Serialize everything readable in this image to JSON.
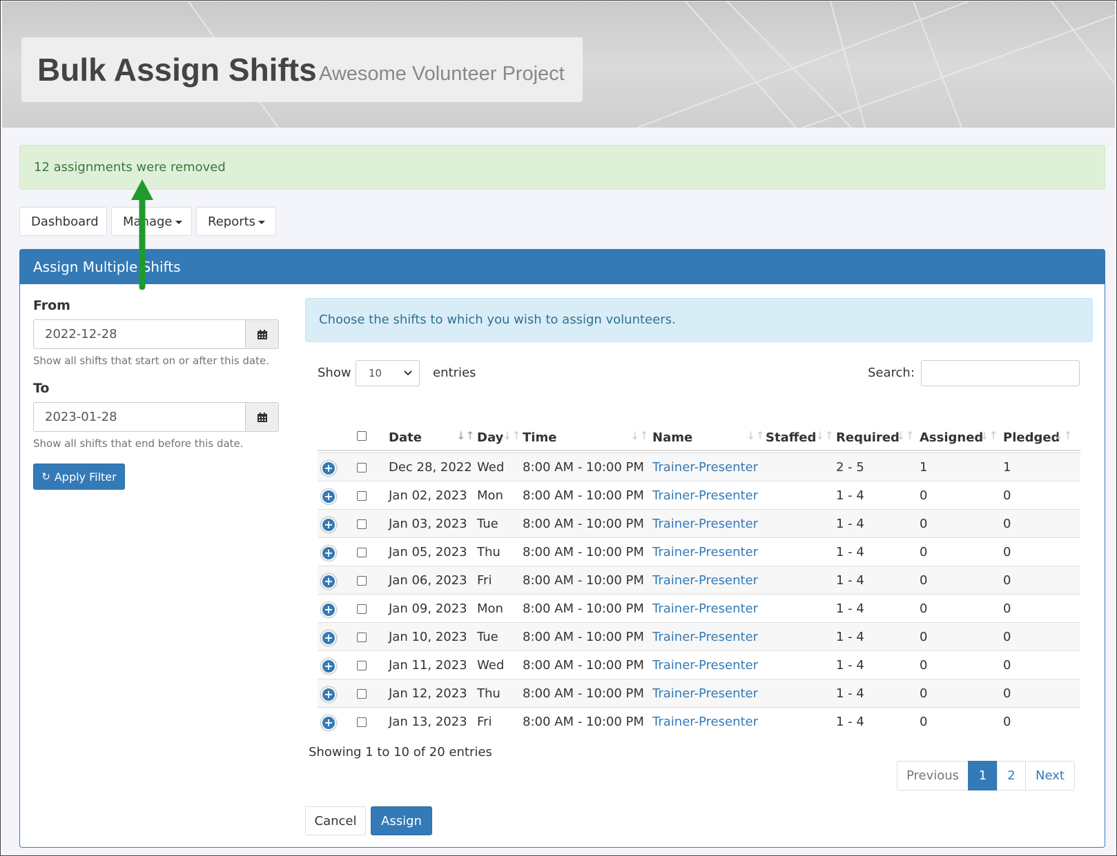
{
  "header": {
    "title": "Bulk Assign Shifts",
    "subtitle": "Awesome Volunteer Project"
  },
  "alert": {
    "message": "12 assignments were removed"
  },
  "nav": {
    "dashboard": "Dashboard",
    "manage": "Manage",
    "reports": "Reports"
  },
  "panel": {
    "heading": "Assign Multiple Shifts",
    "from_label": "From",
    "from_value": "2022-12-28",
    "from_help": "Show all shifts that start on or after this date.",
    "to_label": "To",
    "to_value": "2023-01-28",
    "to_help": "Show all shifts that end before this date.",
    "apply_label": "Apply Filter",
    "info": "Choose the shifts to which you wish to assign volunteers."
  },
  "table_controls": {
    "show_label": "Show",
    "page_size": "10",
    "entries_label": "entries",
    "search_label": "Search:",
    "search_value": ""
  },
  "table": {
    "columns": [
      "Date",
      "Day",
      "Time",
      "Name",
      "Staffed",
      "Required",
      "Assigned",
      "Pledged"
    ],
    "rows": [
      {
        "date": "Dec 28, 2022",
        "day": "Wed",
        "time": "8:00 AM - 10:00 PM",
        "name": "Trainer-Presenter",
        "staffed": "",
        "required": "2 - 5",
        "assigned": "1",
        "pledged": "1"
      },
      {
        "date": "Jan 02, 2023",
        "day": "Mon",
        "time": "8:00 AM - 10:00 PM",
        "name": "Trainer-Presenter",
        "staffed": "",
        "required": "1 - 4",
        "assigned": "0",
        "pledged": "0"
      },
      {
        "date": "Jan 03, 2023",
        "day": "Tue",
        "time": "8:00 AM - 10:00 PM",
        "name": "Trainer-Presenter",
        "staffed": "",
        "required": "1 - 4",
        "assigned": "0",
        "pledged": "0"
      },
      {
        "date": "Jan 05, 2023",
        "day": "Thu",
        "time": "8:00 AM - 10:00 PM",
        "name": "Trainer-Presenter",
        "staffed": "",
        "required": "1 - 4",
        "assigned": "0",
        "pledged": "0"
      },
      {
        "date": "Jan 06, 2023",
        "day": "Fri",
        "time": "8:00 AM - 10:00 PM",
        "name": "Trainer-Presenter",
        "staffed": "",
        "required": "1 - 4",
        "assigned": "0",
        "pledged": "0"
      },
      {
        "date": "Jan 09, 2023",
        "day": "Mon",
        "time": "8:00 AM - 10:00 PM",
        "name": "Trainer-Presenter",
        "staffed": "",
        "required": "1 - 4",
        "assigned": "0",
        "pledged": "0"
      },
      {
        "date": "Jan 10, 2023",
        "day": "Tue",
        "time": "8:00 AM - 10:00 PM",
        "name": "Trainer-Presenter",
        "staffed": "",
        "required": "1 - 4",
        "assigned": "0",
        "pledged": "0"
      },
      {
        "date": "Jan 11, 2023",
        "day": "Wed",
        "time": "8:00 AM - 10:00 PM",
        "name": "Trainer-Presenter",
        "staffed": "",
        "required": "1 - 4",
        "assigned": "0",
        "pledged": "0"
      },
      {
        "date": "Jan 12, 2023",
        "day": "Thu",
        "time": "8:00 AM - 10:00 PM",
        "name": "Trainer-Presenter",
        "staffed": "",
        "required": "1 - 4",
        "assigned": "0",
        "pledged": "0"
      },
      {
        "date": "Jan 13, 2023",
        "day": "Fri",
        "time": "8:00 AM - 10:00 PM",
        "name": "Trainer-Presenter",
        "staffed": "",
        "required": "1 - 4",
        "assigned": "0",
        "pledged": "0"
      }
    ]
  },
  "footer": {
    "showing": "Showing 1 to 10 of 20 entries",
    "previous": "Previous",
    "page1": "1",
    "page2": "2",
    "next": "Next",
    "cancel": "Cancel",
    "assign": "Assign"
  },
  "icons": {
    "calendar": "calendar-icon",
    "refresh": "refresh-icon",
    "expand": "expand-plus-icon",
    "annotation": "arrow-up-annotation"
  },
  "colors": {
    "primary": "#337ab7",
    "success_bg": "#dff0d8",
    "success_text": "#3c763d",
    "info_bg": "#d9edf7",
    "arrow": "#1e9b2c"
  }
}
